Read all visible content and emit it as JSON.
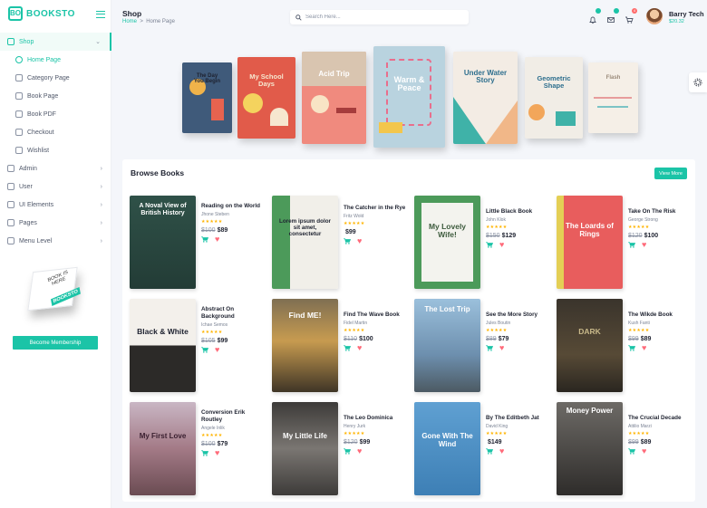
{
  "brand": {
    "name": "BOOKSTO",
    "mark": "BO"
  },
  "sidebar": {
    "items": [
      {
        "label": "Shop",
        "icon": "home-icon",
        "active": true,
        "chevron": "⌄"
      },
      {
        "label": "Home Page",
        "icon": "dot-icon",
        "sub": true,
        "current": true
      },
      {
        "label": "Category Page",
        "icon": "grid-icon",
        "sub": true
      },
      {
        "label": "Book Page",
        "icon": "book-icon",
        "sub": true
      },
      {
        "label": "Book PDF",
        "icon": "file-icon",
        "sub": true
      },
      {
        "label": "Checkout",
        "icon": "copy-icon",
        "sub": true
      },
      {
        "label": "Wishlist",
        "icon": "heart-icon",
        "sub": true
      },
      {
        "label": "Admin",
        "icon": "user-gear-icon",
        "chevron": "›"
      },
      {
        "label": "User",
        "icon": "user-icon",
        "chevron": "›"
      },
      {
        "label": "UI Elements",
        "icon": "layers-icon",
        "chevron": "›"
      },
      {
        "label": "Pages",
        "icon": "pages-icon",
        "chevron": "›"
      },
      {
        "label": "Menu Level",
        "icon": "play-icon",
        "chevron": "›"
      }
    ],
    "promo": {
      "line1": "BOOK IS HERE",
      "line2": "BOOKSTO"
    },
    "membership_button": "Become Membership"
  },
  "header": {
    "title": "Shop",
    "breadcrumb": {
      "home": "Home",
      "separator": ">",
      "current": "Home Page"
    },
    "search_placeholder": "Search Here...",
    "notifications": {
      "bell": "",
      "mail": "",
      "cart": "4"
    },
    "user": {
      "name": "Barry Tech",
      "balance": "$20.32"
    }
  },
  "hero_books": [
    {
      "title": "The Day You Begin",
      "color": "#3f5a7a"
    },
    {
      "title": "My School Days",
      "color": "#e15b4a"
    },
    {
      "title": "Acid Trip",
      "color": "#f08a7e"
    },
    {
      "title": "Warm & Peace",
      "color": "#b9d3df"
    },
    {
      "title": "Under Water Story",
      "color": "#f3ece4"
    },
    {
      "title": "Geometric Shape",
      "color": "#f1ede6"
    },
    {
      "title": "Flash",
      "color": "#f5efe7"
    }
  ],
  "browse": {
    "title": "Browse Books",
    "view_more": "View More",
    "books": [
      {
        "title": "Reading on the World",
        "author": "Jhone Steben",
        "old_price": "$100",
        "price": "$89",
        "cover_text": "A Noval View of British History",
        "cover_bg": "#2f5148",
        "text_color": "#ffffff"
      },
      {
        "title": "The Catcher in the Rye",
        "author": "Fritz Wold",
        "old_price": "",
        "price": "$99",
        "cover_text": "Lorem ipsum dolor sit amet, consectetur",
        "cover_bg": "#f1efe9",
        "text_color": "#1e2230"
      },
      {
        "title": "Little Black Book",
        "author": "John Klok",
        "old_price": "$150",
        "price": "$129",
        "cover_text": "My Lovely Wife!",
        "cover_bg": "#4c9a5a",
        "text_color": "#3c5a3c"
      },
      {
        "title": "Take On The Risk",
        "author": "George Strong",
        "old_price": "$120",
        "price": "$100",
        "cover_text": "The Loards of Rings",
        "cover_bg": "#e85d5d",
        "text_color": "#ffffff"
      },
      {
        "title": "Abstract On Background",
        "author": "Ichae Semos",
        "old_price": "$105",
        "price": "$99",
        "cover_text": "Black & White",
        "cover_bg": "#f3f0eb",
        "text_color": "#1e2230"
      },
      {
        "title": "Find The Wave Book",
        "author": "Fidel Martin",
        "old_price": "$110",
        "price": "$100",
        "cover_text": "Find ME!",
        "cover_bg": "#6b5a3e",
        "text_color": "#ffffff"
      },
      {
        "title": "See the More Story",
        "author": "Jules Boutin",
        "old_price": "$89",
        "price": "$79",
        "cover_text": "The Lost Trip",
        "cover_bg": "#7fa8c9",
        "text_color": "#ffffff"
      },
      {
        "title": "The Wikde Book",
        "author": "Kush Fanti",
        "old_price": "$99",
        "price": "$89",
        "cover_text": "DARK",
        "cover_bg": "#3a342c",
        "text_color": "#c9b98a"
      },
      {
        "title": "Conversion Erik Routley",
        "author": "Angele Inlik",
        "old_price": "$100",
        "price": "$79",
        "cover_text": "My First Love",
        "cover_bg": "#a37a86",
        "text_color": "#3a2030"
      },
      {
        "title": "The Leo Dominica",
        "author": "Henry Jurk",
        "old_price": "$120",
        "price": "$99",
        "cover_text": "My Little Life",
        "cover_bg": "#55524f",
        "text_color": "#ffffff"
      },
      {
        "title": "By The Editbeth Jat",
        "author": "David King",
        "old_price": "",
        "price": "$149",
        "cover_text": "Gone With The Wind",
        "cover_bg": "#4f8fc4",
        "text_color": "#ffffff"
      },
      {
        "title": "The Crucial Decade",
        "author": "Attilio Marzi",
        "old_price": "$99",
        "price": "$89",
        "cover_text": "Money Power",
        "cover_bg": "#3b3937",
        "text_color": "#ffffff"
      }
    ]
  },
  "rating_stars": "★★★★★",
  "colors": {
    "accent": "#1bc4a7",
    "heart": "#ff6b7a",
    "star": "#ffb400"
  }
}
